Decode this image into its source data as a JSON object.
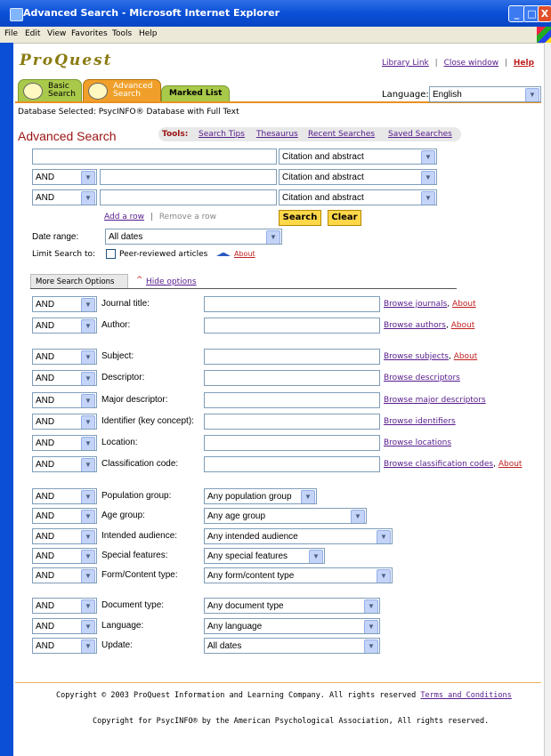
{
  "window": {
    "title": "Advanced Search - Microsoft Internet Explorer",
    "minimize": "_",
    "maximize": "□",
    "close": "X"
  },
  "menu": [
    "File",
    "Edit",
    "View",
    "Favorites",
    "Tools",
    "Help"
  ],
  "brand": {
    "logo": "ProQuest"
  },
  "header_links": {
    "library": "Library Link",
    "close": "Close window",
    "help": "Help",
    "sep": "|"
  },
  "tabs": {
    "basic": [
      "Basic",
      "Search"
    ],
    "advanced": [
      "Advanced",
      "Search"
    ],
    "marked": "Marked List"
  },
  "language": {
    "label": "Language:",
    "value": "English"
  },
  "database_selected": "Database Selected: PsycINFO® Database with Full Text",
  "page_title": "Advanced Search",
  "tools": {
    "label": "Tools:",
    "links": [
      "Search Tips",
      "Thesaurus",
      "Recent Searches",
      "Saved Searches"
    ]
  },
  "search_rows": [
    {
      "op": "",
      "value": "",
      "field": "Citation and abstract"
    },
    {
      "op": "AND",
      "value": "",
      "field": "Citation and abstract"
    },
    {
      "op": "AND",
      "value": "",
      "field": "Citation and abstract"
    }
  ],
  "row_actions": {
    "add": "Add a row",
    "sep": "|",
    "remove": "Remove a row",
    "search": "Search",
    "clear": "Clear"
  },
  "date_range": {
    "label": "Date range:",
    "value": "All dates"
  },
  "limit": {
    "label": "Limit Search to:",
    "option": "Peer-reviewed articles",
    "about": "About"
  },
  "more_options": {
    "tab": "More Search Options",
    "hide": "Hide options"
  },
  "text_fields": [
    {
      "op": "AND",
      "label": "Journal title:",
      "browse": "Browse journals",
      "about": "About"
    },
    {
      "op": "AND",
      "label": "Author:",
      "browse": "Browse authors",
      "about": "About"
    },
    {
      "op": "AND",
      "label": "Subject:",
      "browse": "Browse subjects",
      "about": "About"
    },
    {
      "op": "AND",
      "label": "Descriptor:",
      "browse": "Browse descriptors",
      "about": ""
    },
    {
      "op": "AND",
      "label": "Major descriptor:",
      "browse": "Browse major descriptors",
      "about": ""
    },
    {
      "op": "AND",
      "label": "Identifier (key concept):",
      "browse": "Browse identifiers",
      "about": ""
    },
    {
      "op": "AND",
      "label": "Location:",
      "browse": "Browse locations",
      "about": ""
    },
    {
      "op": "AND",
      "label": "Classification code:",
      "browse": "Browse classification codes",
      "about": "About"
    }
  ],
  "select_fields": [
    {
      "op": "AND",
      "label": "Population group:",
      "value": "Any population group"
    },
    {
      "op": "AND",
      "label": "Age group:",
      "value": "Any age group"
    },
    {
      "op": "AND",
      "label": "Intended audience:",
      "value": "Any intended audience"
    },
    {
      "op": "AND",
      "label": "Special features:",
      "value": "Any special features"
    },
    {
      "op": "AND",
      "label": "Form/Content type:",
      "value": "Any form/content type"
    },
    {
      "op": "AND",
      "label": "Document type:",
      "value": "Any document type"
    },
    {
      "op": "AND",
      "label": "Language:",
      "value": "Any language"
    },
    {
      "op": "AND",
      "label": "Update:",
      "value": "All dates"
    }
  ],
  "footer": {
    "copyright1": "Copyright © 2003 ProQuest Information and Learning Company. All rights reserved",
    "terms": "Terms and Conditions",
    "copyright2": "Copyright for PsycINFO® by the American Psychological Association, All rights reserved."
  }
}
